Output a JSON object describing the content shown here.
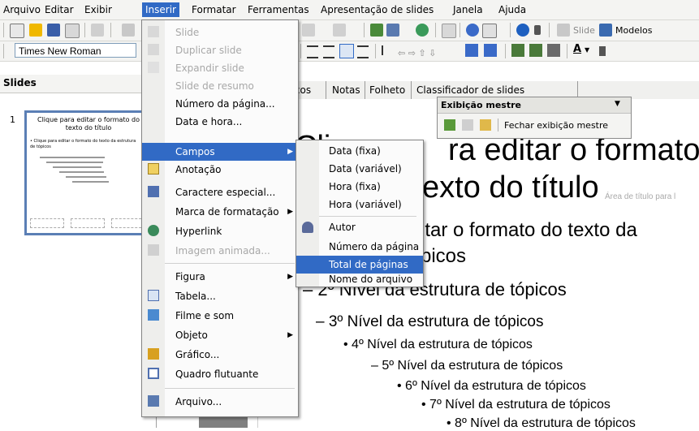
{
  "menubar": {
    "items": [
      "Arquivo",
      "Editar",
      "Exibir",
      "Inserir",
      "Formatar",
      "Ferramentas",
      "Apresentação de slides",
      "Janela",
      "Ajuda"
    ],
    "active": "Inserir"
  },
  "font_toolbar": {
    "font_name": "Times New Roman"
  },
  "toolbar_right": {
    "slide_label": "Slide",
    "modelos_label": "Modelos"
  },
  "slides_pane": {
    "title": "Slides",
    "slide_number": "1",
    "thumb_title": "Clique para editar o formato do texto do título",
    "thumb_line1": "• Clique para editar o formato do texto da estrutura de tópicos"
  },
  "tabs": {
    "items": [
      "ra de tópicos",
      "Notas",
      "Folheto",
      "Classificador de slides"
    ]
  },
  "master_toolbar": {
    "title": "Exibição mestre",
    "close_label": "Fechar exibição mestre"
  },
  "slide": {
    "title_line1": "Cli",
    "title_right1": "ra editar o formato",
    "title_right2": "exto do título",
    "title_area_hint": "Área de título para l",
    "outline_right1": "itar o formato do texto da",
    "outline_right2": "picos",
    "level2": "2º Nível da estrutura de tópicos",
    "level3": "3º Nível da estrutura de tópicos",
    "level4": "4º Nível da estrutura de tópicos",
    "level5": "5º Nível da estrutura de tópicos",
    "level6": "6º Nível da estrutura de tópicos",
    "level7": "7º Nível da estrutura de tópicos",
    "level8": "8º Nível da estrutura de tópicos"
  },
  "insert_menu": {
    "items": [
      {
        "label": "Slide",
        "disabled": true
      },
      {
        "label": "Duplicar slide",
        "disabled": true
      },
      {
        "label": "Expandir slide",
        "disabled": true
      },
      {
        "label": "Slide de resumo",
        "disabled": true
      },
      {
        "label": "Número da página...",
        "disabled": false
      },
      {
        "label": "Data e hora...",
        "disabled": false
      },
      {
        "label": "Campos",
        "disabled": false
      },
      {
        "label": "Anotação",
        "disabled": false
      },
      {
        "label": "Caractere especial...",
        "disabled": false
      },
      {
        "label": "Marca de formatação",
        "disabled": false
      },
      {
        "label": "Hyperlink",
        "disabled": false
      },
      {
        "label": "Imagem animada...",
        "disabled": true
      },
      {
        "label": "Figura",
        "disabled": false
      },
      {
        "label": "Tabela...",
        "disabled": false
      },
      {
        "label": "Filme e som",
        "disabled": false
      },
      {
        "label": "Objeto",
        "disabled": false
      },
      {
        "label": "Gráfico...",
        "disabled": false
      },
      {
        "label": "Quadro flutuante",
        "disabled": false
      },
      {
        "label": "Arquivo...",
        "disabled": false
      }
    ]
  },
  "fields_menu": {
    "items": [
      {
        "label": "Data (fixa)"
      },
      {
        "label": "Data (variável)"
      },
      {
        "label": "Hora (fixa)"
      },
      {
        "label": "Hora (variável)"
      },
      {
        "label": "Autor"
      },
      {
        "label": "Número da página"
      },
      {
        "label": "Total de páginas"
      },
      {
        "label": "Nome do arquivo"
      }
    ],
    "highlighted": "Total de páginas"
  },
  "colors": {
    "highlight": "#316ac5",
    "chrome": "#f4f4f2",
    "gray_area": "#808080"
  }
}
